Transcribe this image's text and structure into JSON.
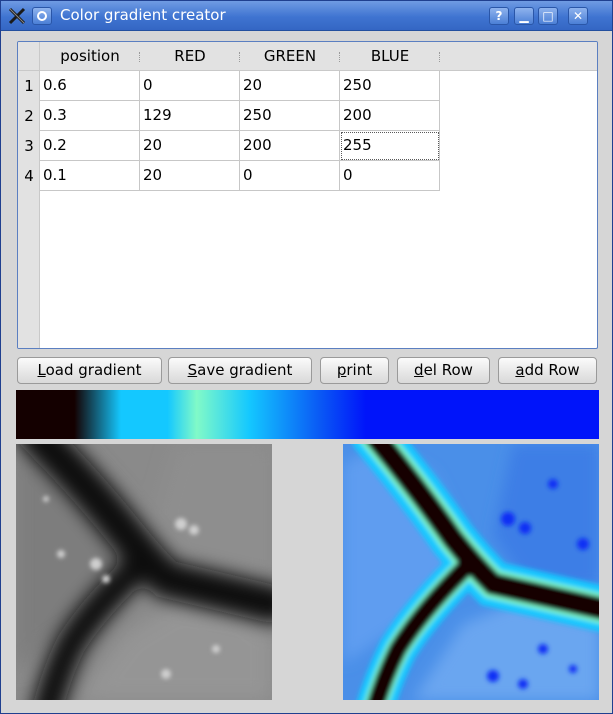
{
  "window": {
    "title": "Color gradient creator",
    "help_label": "?",
    "min_label": "▁",
    "max_label": "□",
    "close_label": "✕"
  },
  "table": {
    "columns": [
      "position",
      "RED",
      "GREEN",
      "BLUE"
    ],
    "row_numbers": [
      "1",
      "2",
      "3",
      "4"
    ],
    "rows": [
      [
        "0.6",
        "0",
        "20",
        "250"
      ],
      [
        "0.3",
        "129",
        "250",
        "200"
      ],
      [
        "0.2",
        "20",
        "200",
        "255"
      ],
      [
        "0.1",
        "20",
        "0",
        "0"
      ]
    ]
  },
  "buttons": {
    "load_gradient": "Load gradient",
    "save_gradient": "Save gradient",
    "print": "print",
    "del_row": "del Row",
    "add_row": "add Row"
  },
  "colors": {
    "titlebar": "#3f74d1",
    "gradient_dark": "#140000",
    "gradient_cyan": "#14c8ff",
    "gradient_mint": "#81fac8",
    "gradient_blue": "#0014fa"
  }
}
